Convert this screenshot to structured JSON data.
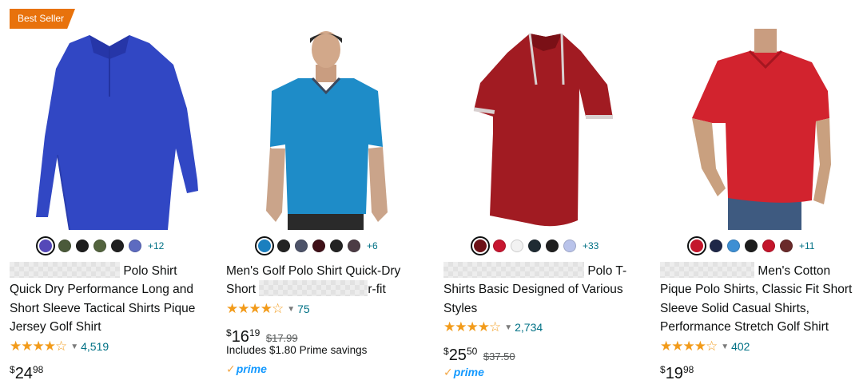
{
  "badge": "Best Seller",
  "products": [
    {
      "title_rest": "Polo Shirt",
      "title_lines": [
        "Quick Dry Performance Long and",
        "Short Sleeve Tactical Shirts Pique",
        "Jersey Golf Shirt"
      ],
      "swatch_colors": [
        "#5548b8",
        "#4b5a3a",
        "#1d1d1d",
        "#53643e",
        "#212121",
        "#5d6bc0"
      ],
      "more_colors": "+12",
      "stars": "★★★★☆",
      "rating": 4.5,
      "reviews": "4,519",
      "price_symbol": "$",
      "price_whole": "24",
      "price_fraction": "98"
    },
    {
      "title_line1": "Men's Golf Polo Shirt Quick-Dry",
      "title_line2_start": "Short",
      "title_line2_end": "r-fit",
      "swatch_colors": [
        "#1b7fbf",
        "#232323",
        "#4d5369",
        "#3f1018",
        "#232323",
        "#4c3c45"
      ],
      "more_colors": "+6",
      "stars": "★★★★☆",
      "rating": 4.5,
      "reviews": "75",
      "price_symbol": "$",
      "price_whole": "16",
      "price_fraction": "19",
      "list_price": "$17.99",
      "savings": "Includes $1.80 Prime savings",
      "prime": "prime"
    },
    {
      "title_rest": "Polo T-",
      "title_lines": [
        "Shirts Basic Designed of Various",
        "Styles"
      ],
      "swatch_colors": [
        "#6d1218",
        "#c71630",
        "#f2f2f2",
        "#1f2b33",
        "#202020",
        "#b9c3ea"
      ],
      "more_colors": "+33",
      "stars": "★★★★☆",
      "rating": 4.0,
      "reviews": "2,734",
      "price_symbol": "$",
      "price_whole": "25",
      "price_fraction": "50",
      "list_price": "$37.50",
      "prime": "prime"
    },
    {
      "title_rest": "Men's Cotton",
      "title_lines": [
        "Pique Polo Shirts, Classic Fit Short",
        "Sleeve Solid Casual Shirts,",
        "Performance Stretch Golf Shirt"
      ],
      "swatch_colors": [
        "#c3152b",
        "#1e2748",
        "#3e8fd3",
        "#1d1d1d",
        "#c3152b",
        "#6a2a2a"
      ],
      "more_colors": "+11",
      "stars": "★★★★☆",
      "rating": 4.5,
      "reviews": "402",
      "price_symbol": "$",
      "price_whole": "19",
      "price_fraction": "98"
    }
  ]
}
